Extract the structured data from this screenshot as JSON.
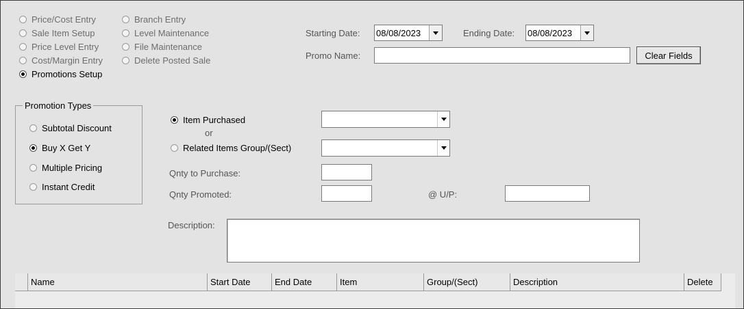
{
  "screens": {
    "left": [
      {
        "label": "Price/Cost Entry",
        "selected": false
      },
      {
        "label": "Sale Item Setup",
        "selected": false
      },
      {
        "label": "Price Level Entry",
        "selected": false
      },
      {
        "label": "Cost/Margin Entry",
        "selected": false
      },
      {
        "label": "Promotions Setup",
        "selected": true
      }
    ],
    "right": [
      {
        "label": "Branch Entry",
        "selected": false
      },
      {
        "label": "Level Maintenance",
        "selected": false
      },
      {
        "label": "File Maintenance",
        "selected": false
      },
      {
        "label": "Delete Posted Sale",
        "selected": false
      }
    ]
  },
  "header": {
    "starting_date_label": "Starting Date:",
    "starting_date_value": "08/08/2023",
    "ending_date_label": "Ending Date:",
    "ending_date_value": "08/08/2023",
    "promo_name_label": "Promo Name:",
    "promo_name_value": "",
    "clear_fields_label": "Clear Fields"
  },
  "promotion_types": {
    "title": "Promotion Types",
    "options": [
      {
        "label": "Subtotal Discount",
        "selected": false
      },
      {
        "label": "Buy X Get Y",
        "selected": true
      },
      {
        "label": "Multiple Pricing",
        "selected": false
      },
      {
        "label": "Instant Credit",
        "selected": false
      }
    ]
  },
  "item_section": {
    "item_purchased_label": "Item Purchased",
    "or_label": "or",
    "related_group_label": "Related Items Group/(Sect)",
    "item_purchased_value": "",
    "related_group_value": "",
    "qnty_purchase_label": "Qnty to Purchase:",
    "qnty_purchase_value": "",
    "qnty_promoted_label": "Qnty Promoted:",
    "qnty_promoted_value": "",
    "unit_price_label": "@ U/P:",
    "unit_price_value": "",
    "description_label": "Description:",
    "description_value": ""
  },
  "grid": {
    "columns": [
      "Name",
      "Start Date",
      "End Date",
      "Item",
      "Group/(Sect)",
      "Description",
      "Delete"
    ]
  },
  "colors": {
    "background": "#e3e3e3",
    "border": "#3c3c3c",
    "label_gray": "#555555"
  },
  "icons": [
    "radio-selected-icon",
    "radio-unselected-icon",
    "dropdown-arrow-icon"
  ]
}
